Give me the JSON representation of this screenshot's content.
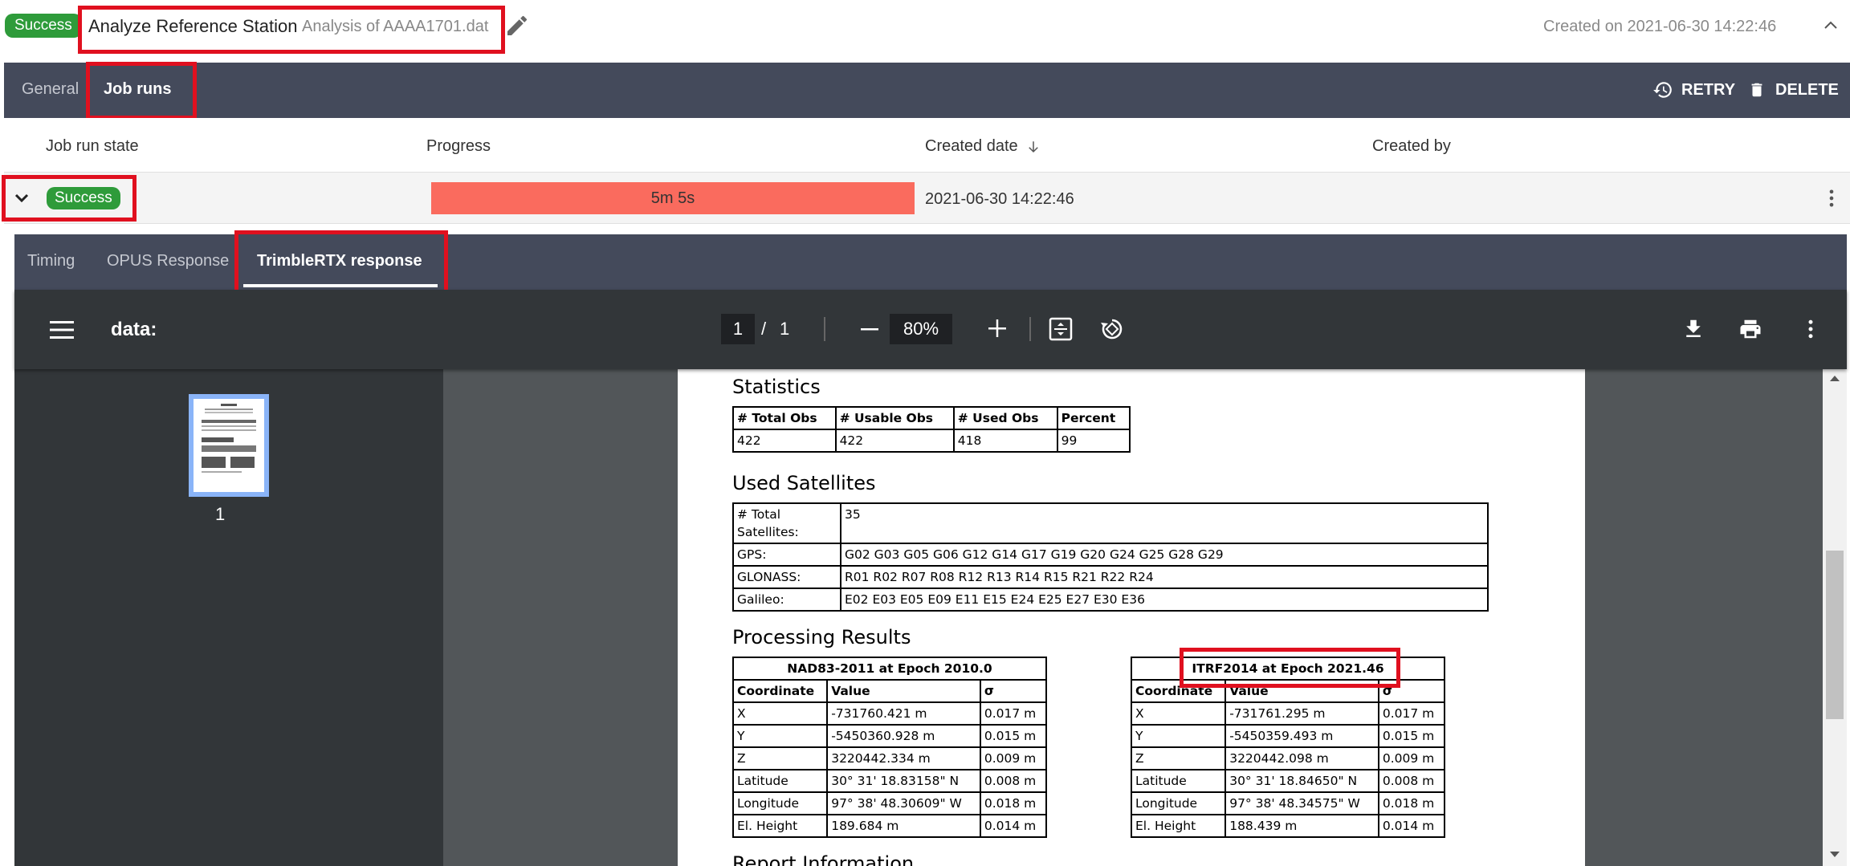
{
  "header": {
    "status": "Success",
    "title": "Analyze Reference Station",
    "subtitle": "Analysis of AAAA1701.dat",
    "created_on": "Created on 2021-06-30 14:22:46"
  },
  "tabs": {
    "general": "General",
    "job_runs": "Job runs",
    "retry": "RETRY",
    "delete": "DELETE"
  },
  "table": {
    "columns": [
      "Job run state",
      "Progress",
      "Created date",
      "Created by"
    ],
    "row": {
      "status": "Success",
      "progress_label": "5m 5s",
      "progress_percent": 100,
      "created_date": "2021-06-30 14:22:46",
      "created_by": ""
    }
  },
  "inner_tabs": {
    "timing": "Timing",
    "opus": "OPUS Response",
    "trimble": "TrimbleRTX response"
  },
  "pdf": {
    "title": "data:",
    "page": "1",
    "sep": "/",
    "total": "1",
    "zoom": "80%",
    "thumb_num": "1",
    "statistics": {
      "title": "Statistics",
      "headers": [
        "# Total Obs",
        "# Usable Obs",
        "# Used Obs",
        "Percent"
      ],
      "values": [
        "422",
        "422",
        "418",
        "99"
      ]
    },
    "satellites": {
      "title": "Used Satellites",
      "rows": [
        [
          "# Total Satellites:",
          "35"
        ],
        [
          "GPS:",
          "G02 G03 G05 G06 G12 G14 G17 G19 G20 G24 G25 G28 G29"
        ],
        [
          "GLONASS:",
          "R01 R02 R07 R08 R12 R13 R14 R15 R21 R22 R24"
        ],
        [
          "Galileo:",
          "E02 E03 E05 E09 E11 E15 E24 E25 E27 E30 E36"
        ]
      ]
    },
    "processing": {
      "title": "Processing Results",
      "nad": {
        "caption": "NAD83-2011 at Epoch 2010.0",
        "headers": [
          "Coordinate",
          "Value",
          "σ"
        ],
        "rows": [
          [
            "X",
            "-731760.421 m",
            "0.017 m"
          ],
          [
            "Y",
            "-5450360.928 m",
            "0.015 m"
          ],
          [
            "Z",
            "3220442.334 m",
            "0.009 m"
          ],
          [
            "Latitude",
            "30° 31' 18.83158\" N",
            "0.008 m"
          ],
          [
            "Longitude",
            "97° 38' 48.30609\" W",
            "0.018 m"
          ],
          [
            "El. Height",
            "189.684 m",
            "0.014 m"
          ]
        ]
      },
      "itrf": {
        "caption": "ITRF2014 at Epoch 2021.46",
        "headers": [
          "Coordinate",
          "Value",
          "σ"
        ],
        "rows": [
          [
            "X",
            "-731761.295 m",
            "0.017 m"
          ],
          [
            "Y",
            "-5450359.493 m",
            "0.015 m"
          ],
          [
            "Z",
            "3220442.098 m",
            "0.009 m"
          ],
          [
            "Latitude",
            "30° 31' 18.84650\" N",
            "0.008 m"
          ],
          [
            "Longitude",
            "97° 38' 48.34575\" W",
            "0.018 m"
          ],
          [
            "El. Height",
            "188.439 m",
            "0.014 m"
          ]
        ]
      }
    },
    "report_info_partial": "Report Information"
  },
  "colors": {
    "success": "#2e9b3a",
    "tabbar": "#444a5b",
    "progress": "#fa6b5e",
    "highlight": "#e0101f"
  }
}
